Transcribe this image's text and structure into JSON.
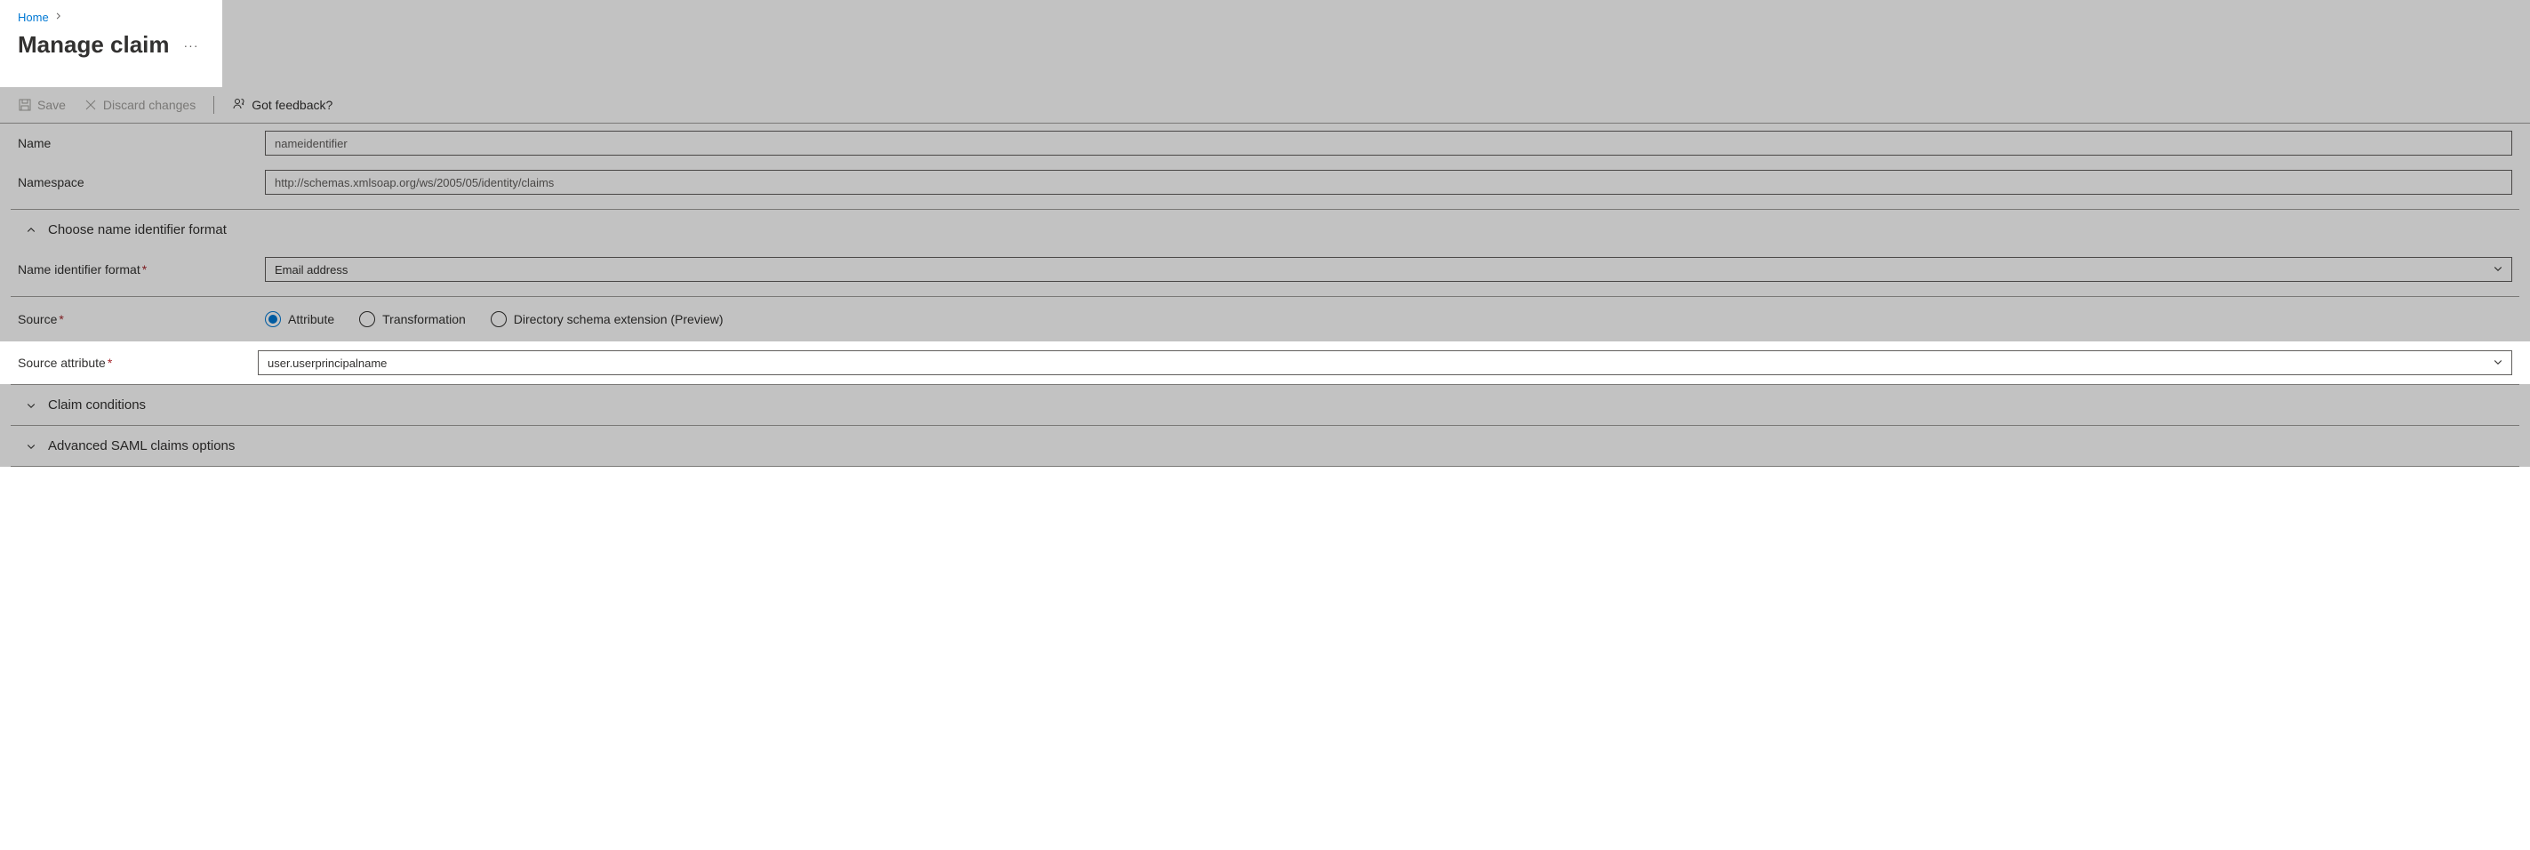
{
  "breadcrumb": {
    "home": "Home"
  },
  "page": {
    "title": "Manage claim"
  },
  "commands": {
    "save": "Save",
    "discard": "Discard changes",
    "feedback": "Got feedback?"
  },
  "fields": {
    "name": {
      "label": "Name",
      "placeholder": "nameidentifier"
    },
    "namespace": {
      "label": "Namespace",
      "placeholder": "http://schemas.xmlsoap.org/ws/2005/05/identity/claims"
    },
    "nif_section": "Choose name identifier format",
    "nif": {
      "label": "Name identifier format",
      "value": "Email address"
    },
    "source": {
      "label": "Source",
      "options": {
        "attribute": "Attribute",
        "transformation": "Transformation",
        "dse": "Directory schema extension (Preview)"
      }
    },
    "source_attribute": {
      "label": "Source attribute",
      "value": "user.userprincipalname"
    },
    "claim_conditions": "Claim conditions",
    "advanced": "Advanced SAML claims options"
  }
}
